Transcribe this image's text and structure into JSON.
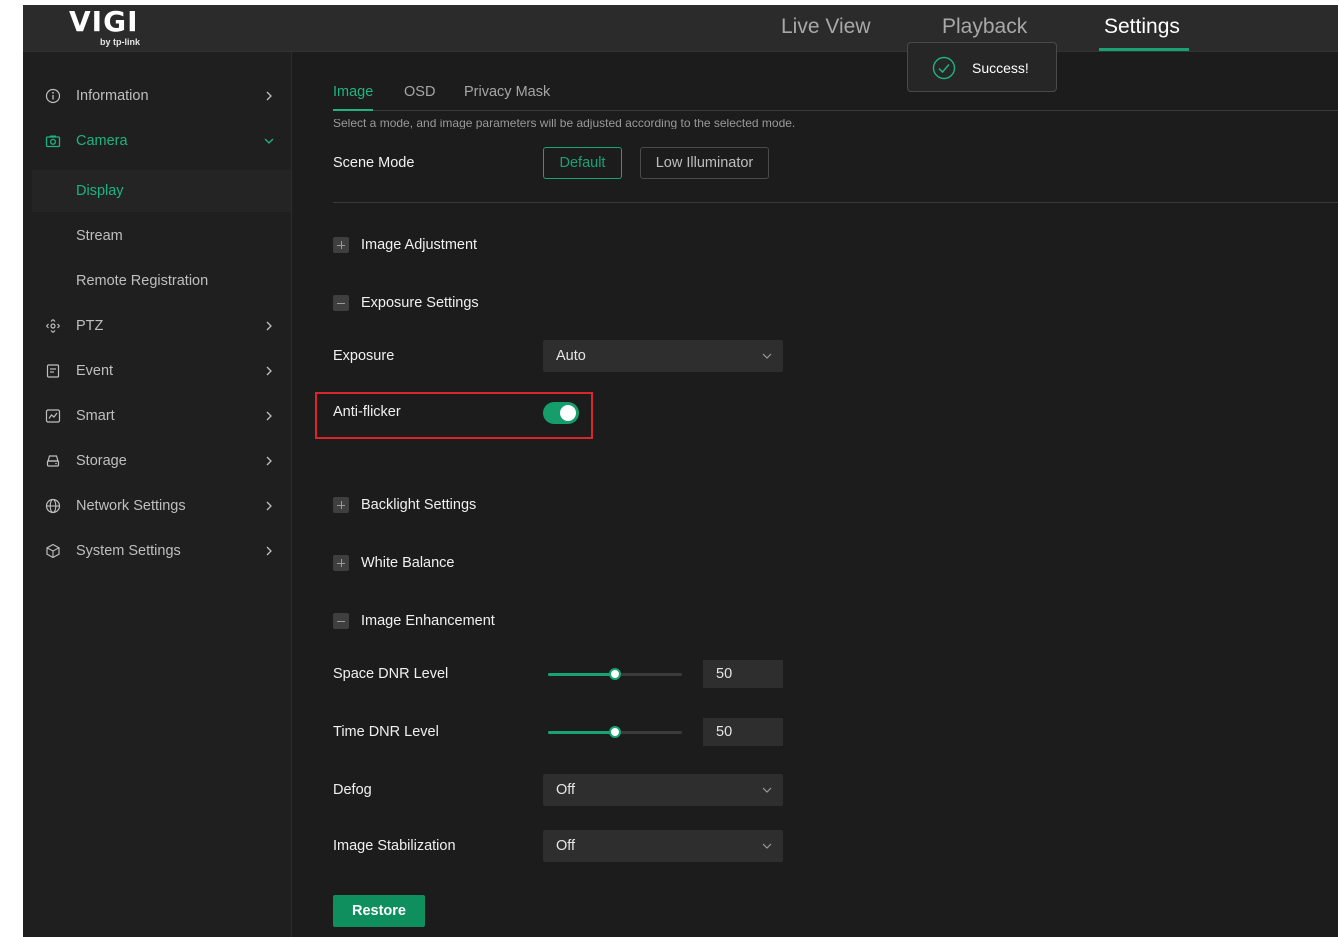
{
  "brand": {
    "logo_main": "VIGI",
    "logo_sub": "by tp-link"
  },
  "top_nav": {
    "live_view": "Live View",
    "playback": "Playback",
    "settings": "Settings",
    "active": "Settings"
  },
  "toast": {
    "message": "Success!",
    "icon": "check-circle-icon"
  },
  "sidebar": {
    "items": [
      {
        "label": "Information",
        "icon": "info-icon"
      },
      {
        "label": "Camera",
        "icon": "camera-icon",
        "expanded": true
      },
      {
        "label": "PTZ",
        "icon": "ptz-icon"
      },
      {
        "label": "Event",
        "icon": "event-icon"
      },
      {
        "label": "Smart",
        "icon": "smart-icon"
      },
      {
        "label": "Storage",
        "icon": "storage-icon"
      },
      {
        "label": "Network Settings",
        "icon": "globe-icon"
      },
      {
        "label": "System Settings",
        "icon": "system-icon"
      }
    ],
    "camera_sub": [
      {
        "label": "Display",
        "active": true
      },
      {
        "label": "Stream"
      },
      {
        "label": "Remote Registration"
      }
    ]
  },
  "tabs": {
    "image": "Image",
    "osd": "OSD",
    "privacy_mask": "Privacy Mask",
    "active": "Image"
  },
  "scene": {
    "hint": "Select a mode, and image parameters will be adjusted according to the selected mode.",
    "label": "Scene Mode",
    "default_button": "Default",
    "low_illuminator_button": "Low Illuminator",
    "selected": "Default"
  },
  "sections": {
    "image_adjustment": "Image Adjustment",
    "exposure_settings": "Exposure Settings",
    "backlight_settings": "Backlight Settings",
    "white_balance": "White Balance",
    "image_enhancement": "Image Enhancement"
  },
  "exposure": {
    "label": "Exposure",
    "value": "Auto"
  },
  "anti_flicker": {
    "label": "Anti-flicker",
    "enabled": true
  },
  "space_dnr": {
    "label": "Space DNR Level",
    "value": "50",
    "fraction": 0.5
  },
  "time_dnr": {
    "label": "Time DNR Level",
    "value": "50",
    "fraction": 0.5
  },
  "defog": {
    "label": "Defog",
    "value": "Off"
  },
  "image_stabilization": {
    "label": "Image Stabilization",
    "value": "Off"
  },
  "restore_button": "Restore",
  "colors": {
    "accent": "#17a374",
    "background": "#1c1c1c",
    "highlight_border": "#d9252b"
  }
}
